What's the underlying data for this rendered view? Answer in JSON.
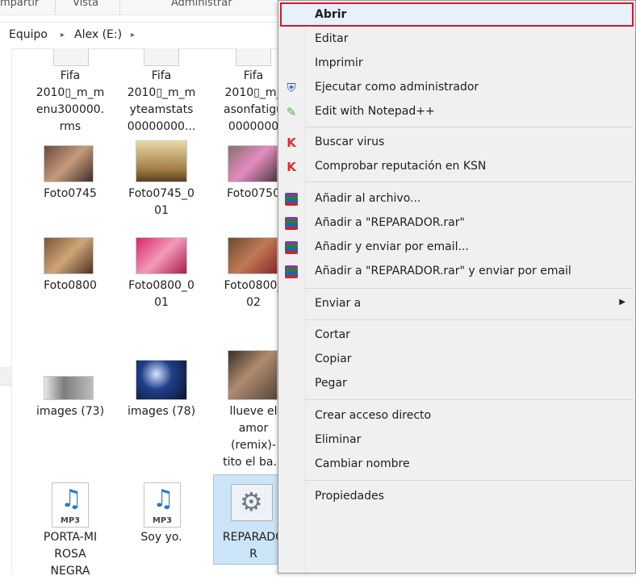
{
  "ribbon": {
    "tab1": "mpartir",
    "tab2": "Vista",
    "tab3": "Administrar"
  },
  "breadcrumb": {
    "item1": "Equipo",
    "item2": "Alex (E:)"
  },
  "files": [
    {
      "label": "Fifa\n2010▯_m_m\nenu300000.\nrms"
    },
    {
      "label": "Fifa\n2010▯_m_m\nyteamstats\n00000000..."
    },
    {
      "label": "Fifa\n2010▯_m_\nasonfatigu\n0000000"
    },
    {
      "label": "Foto0745"
    },
    {
      "label": "Foto0745_0\n01"
    },
    {
      "label": "Foto0750"
    },
    {
      "label": "Foto0800"
    },
    {
      "label": "Foto0800_0\n01"
    },
    {
      "label": "Foto0800_\n02"
    },
    {
      "label": "images (73)"
    },
    {
      "label": "images (78)"
    },
    {
      "label": "llueve el\namor\n(remix)-\ntito el ba..."
    },
    {
      "label": "PORTA-MI\nROSA\nNEGRA"
    },
    {
      "label": "Soy yo."
    },
    {
      "label": "REPARADO\nR"
    }
  ],
  "mp3_tag": "MP3",
  "context_menu": {
    "items": [
      {
        "label": "Abrir",
        "icon": ""
      },
      {
        "label": "Editar",
        "icon": ""
      },
      {
        "label": "Imprimir",
        "icon": ""
      },
      {
        "label": "Ejecutar como administrador",
        "icon": "shield-icon"
      },
      {
        "label": "Edit with Notepad++",
        "icon": "notepadpp-icon"
      },
      {
        "label": "Buscar virus",
        "icon": "kaspersky-icon"
      },
      {
        "label": "Comprobar reputación en KSN",
        "icon": "kaspersky-icon"
      },
      {
        "label": "Añadir al archivo...",
        "icon": "winrar-icon"
      },
      {
        "label": "Añadir a \"REPARADOR.rar\"",
        "icon": "winrar-icon"
      },
      {
        "label": "Añadir y enviar por email...",
        "icon": "winrar-icon"
      },
      {
        "label": "Añadir a \"REPARADOR.rar\" y enviar por email",
        "icon": "winrar-icon"
      },
      {
        "label": "Enviar a",
        "icon": ""
      },
      {
        "label": "Cortar",
        "icon": ""
      },
      {
        "label": "Copiar",
        "icon": ""
      },
      {
        "label": "Pegar",
        "icon": ""
      },
      {
        "label": "Crear acceso directo",
        "icon": ""
      },
      {
        "label": "Eliminar",
        "icon": ""
      },
      {
        "label": "Cambiar nombre",
        "icon": ""
      },
      {
        "label": "Propiedades",
        "icon": ""
      }
    ]
  },
  "colors": {
    "highlight": "#e5f1fb",
    "callout": "#d8192a",
    "selection": "#cce4f7"
  }
}
